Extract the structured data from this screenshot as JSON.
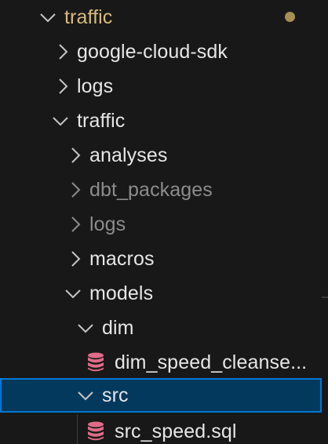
{
  "explorer": {
    "root": {
      "label": "traffic",
      "modified": true
    },
    "items": [
      {
        "label": "google-cloud-sdk",
        "expanded": false,
        "icon": "chevron-right-icon"
      },
      {
        "label": "logs",
        "expanded": false,
        "icon": "chevron-right-icon"
      },
      {
        "label": "traffic",
        "expanded": true,
        "icon": "chevron-down-icon"
      },
      {
        "label": "analyses",
        "expanded": false,
        "icon": "chevron-right-icon"
      },
      {
        "label": "dbt_packages",
        "expanded": false,
        "icon": "chevron-right-icon",
        "ignored": true
      },
      {
        "label": "logs",
        "expanded": false,
        "icon": "chevron-right-icon",
        "ignored": true
      },
      {
        "label": "macros",
        "expanded": false,
        "icon": "chevron-right-icon"
      },
      {
        "label": "models",
        "expanded": true,
        "icon": "chevron-down-icon"
      },
      {
        "label": "dim",
        "expanded": true,
        "icon": "chevron-down-icon"
      },
      {
        "label": "dim_speed_cleanse...",
        "file": true,
        "icon": "database-icon"
      },
      {
        "label": "src",
        "expanded": true,
        "icon": "chevron-down-icon",
        "selected": true
      },
      {
        "label": "src_speed.sql",
        "file": true,
        "icon": "database-icon"
      }
    ]
  },
  "colors": {
    "background": "#181818",
    "modified": "#d7ba7d",
    "ignored": "#8c8c8c",
    "selection": "#04395e",
    "focus_border": "#0078d4",
    "sql_icon": "#e06c8a"
  }
}
